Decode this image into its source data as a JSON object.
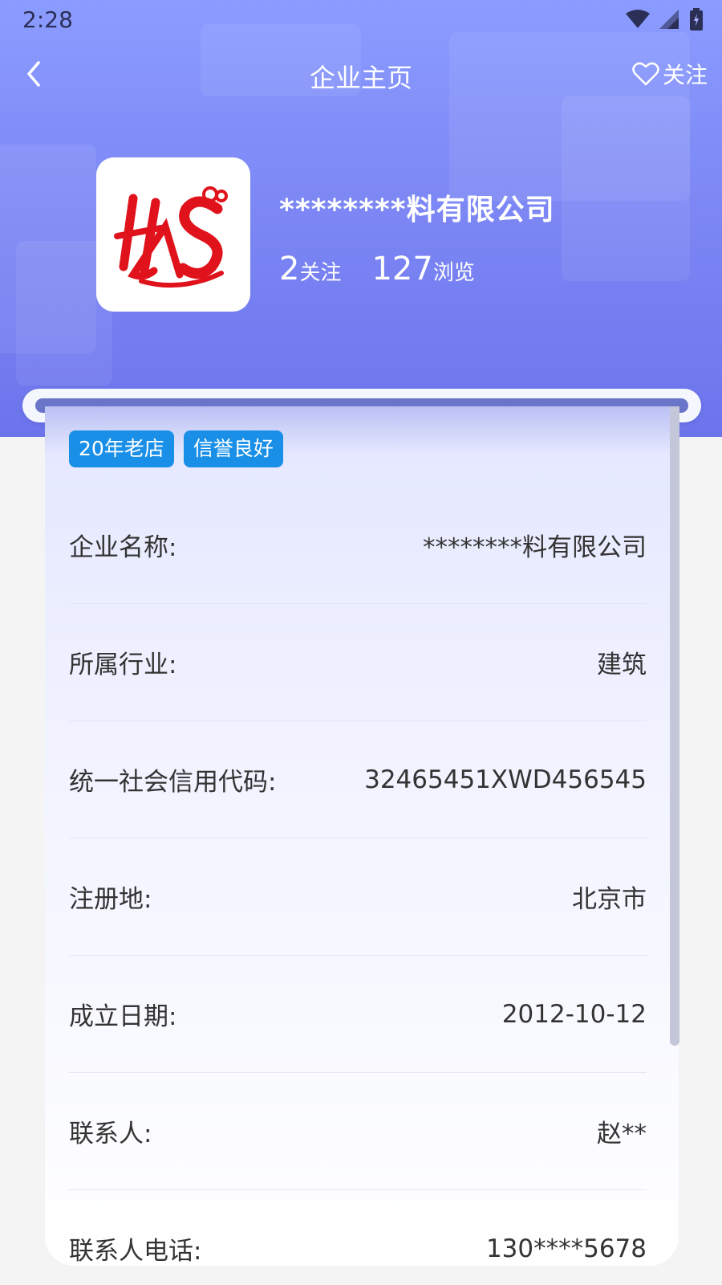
{
  "status_bar": {
    "time": "2:28"
  },
  "nav": {
    "title": "企业主页",
    "follow_label": "关注"
  },
  "company": {
    "name": "********料有限公司",
    "follow_count": "2",
    "follow_label": "关注",
    "view_count": "127",
    "view_label": "浏览"
  },
  "badges": [
    "20年老店",
    "信誉良好"
  ],
  "details": [
    {
      "label": "企业名称:",
      "value": "********料有限公司"
    },
    {
      "label": "所属行业:",
      "value": "建筑"
    },
    {
      "label": "统一社会信用代码:",
      "value": "32465451XWD456545"
    },
    {
      "label": "注册地:",
      "value": "北京市"
    },
    {
      "label": "成立日期:",
      "value": "2012-10-12"
    },
    {
      "label": "联系人:",
      "value": "赵**"
    },
    {
      "label": "联系人电话:",
      "value": "130****5678"
    }
  ],
  "colors": {
    "hero": "#7d88f5",
    "badge": "#1a8fe8",
    "logo_red": "#e0121b"
  }
}
